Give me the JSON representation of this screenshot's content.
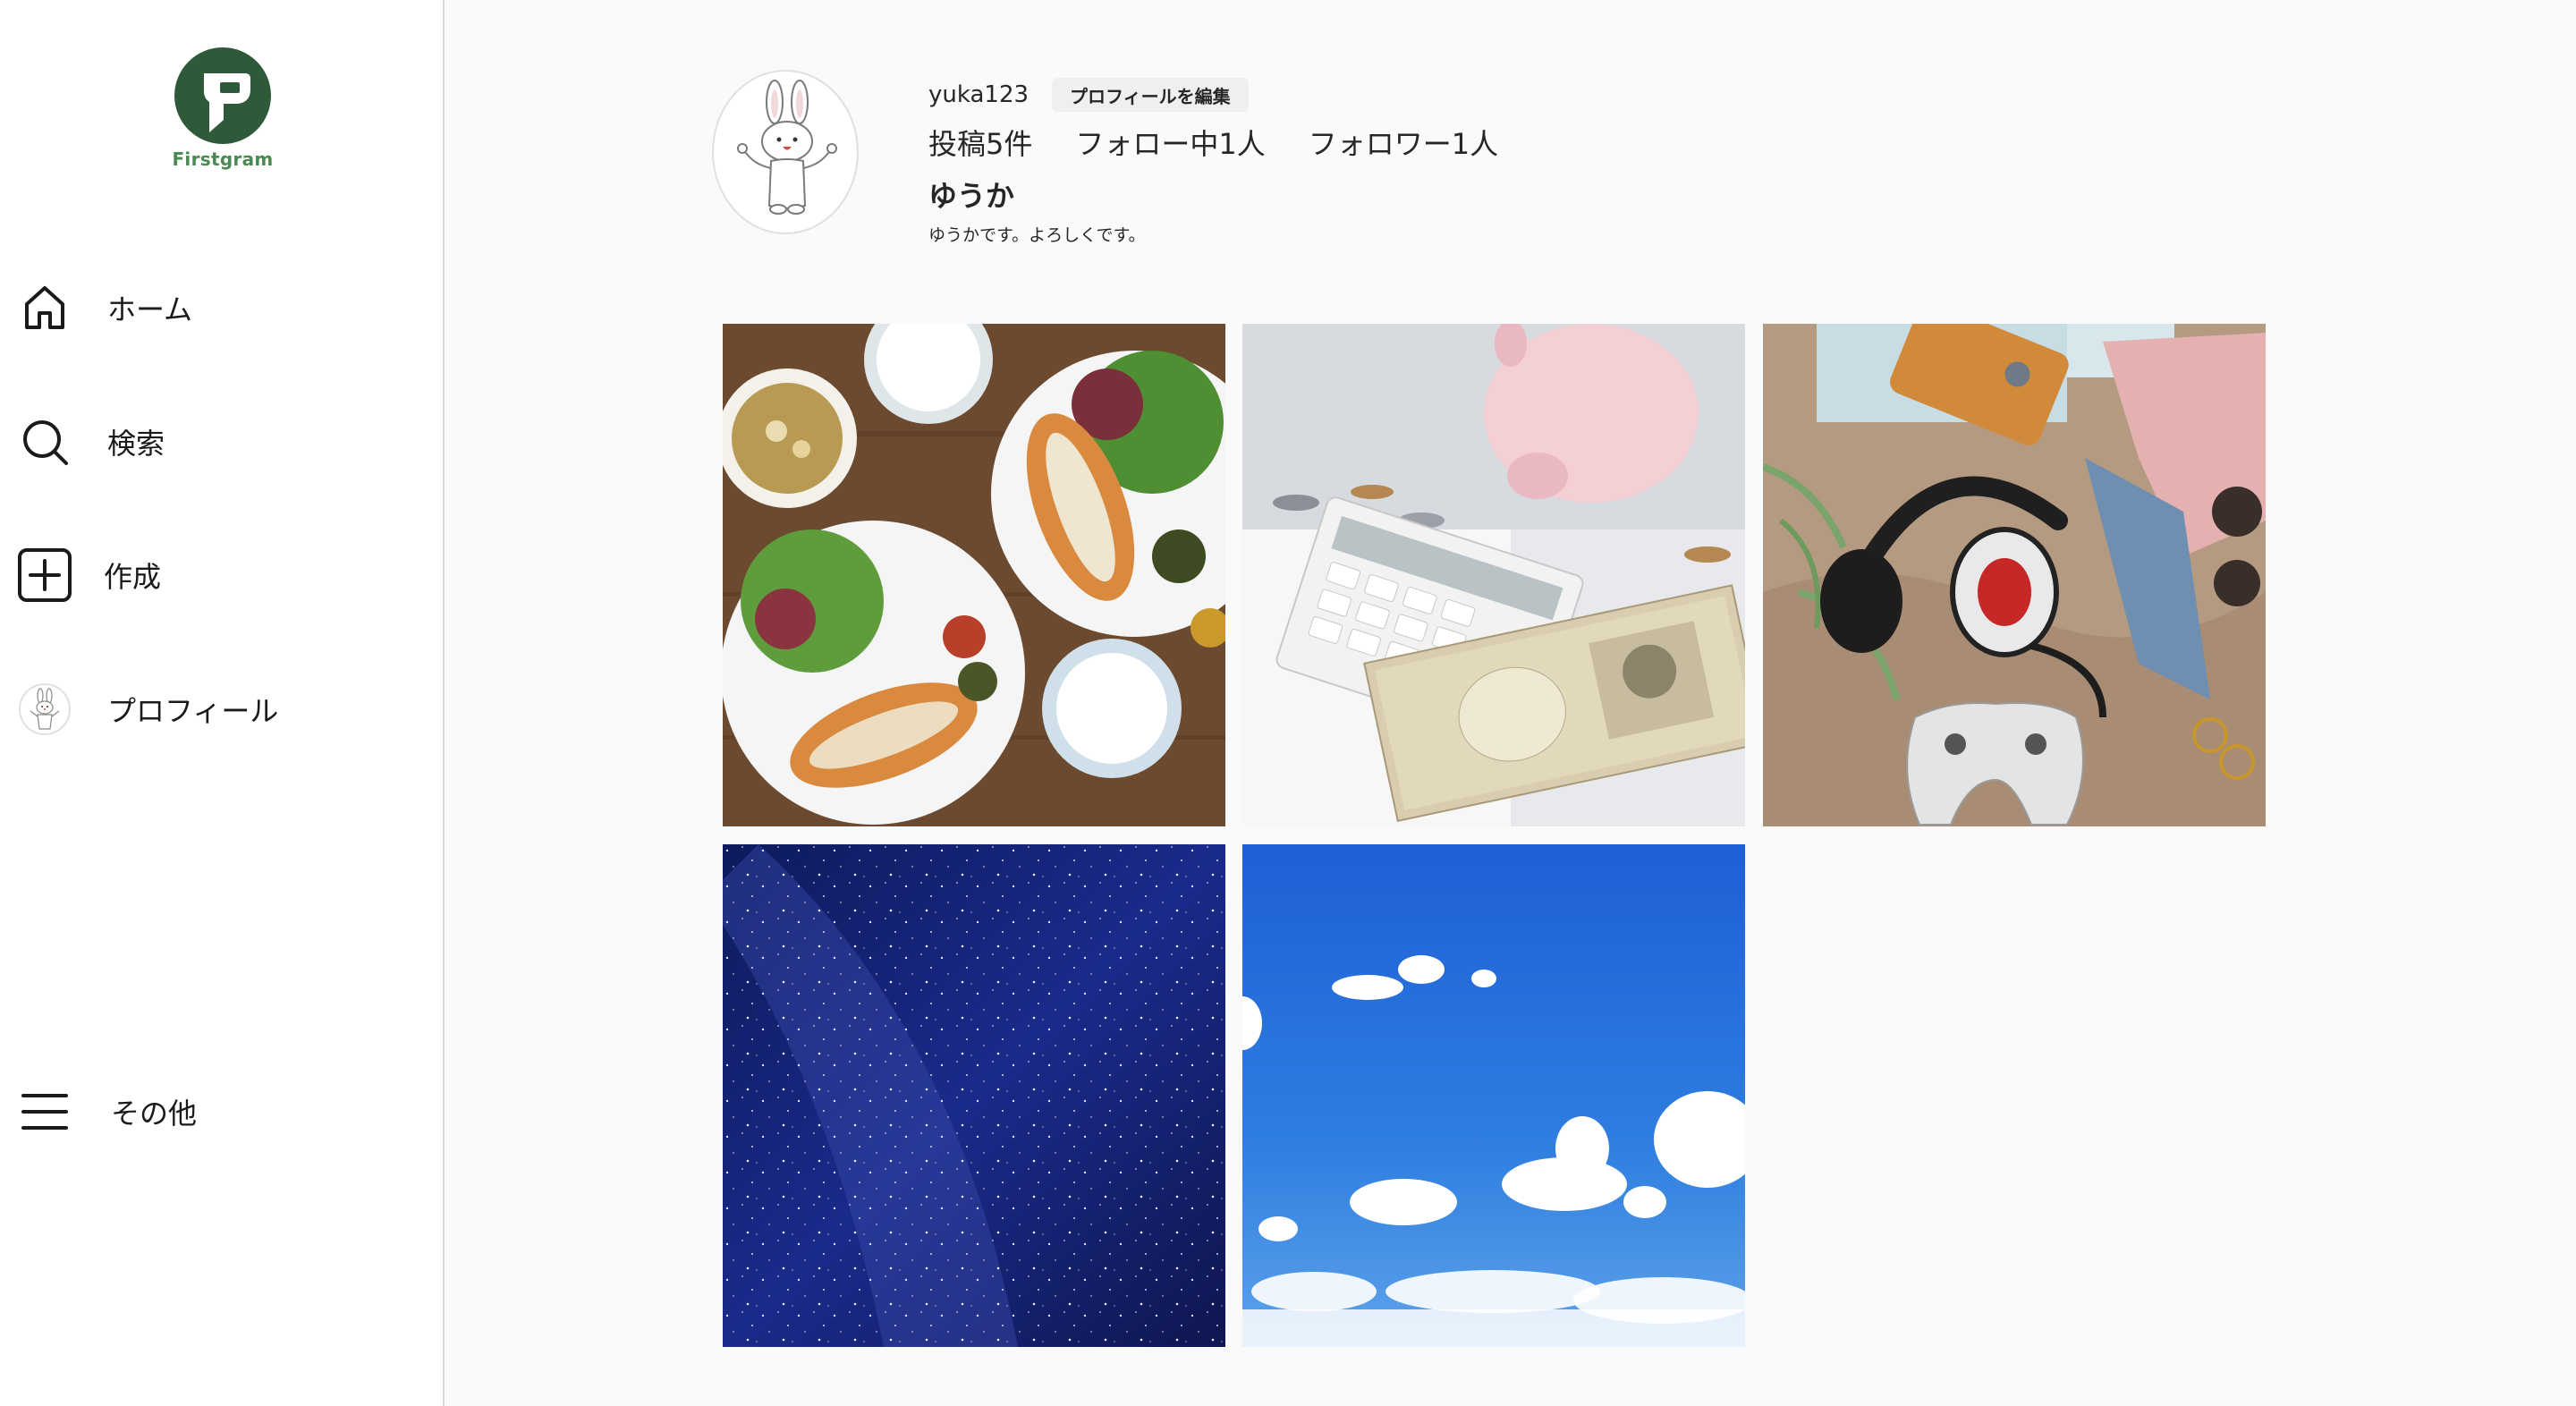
{
  "brand": {
    "name": "Firstgram",
    "logo_color": "#2f5a3a",
    "text_color": "#4a8a52"
  },
  "sidebar": {
    "items": [
      {
        "label": "ホーム",
        "icon": "home-icon"
      },
      {
        "label": "検索",
        "icon": "search-icon"
      },
      {
        "label": "作成",
        "icon": "plus-square-icon"
      },
      {
        "label": "プロフィール",
        "icon": "avatar"
      },
      {
        "label": "その他",
        "icon": "menu-icon"
      }
    ]
  },
  "profile": {
    "username": "yuka123",
    "edit_button": "プロフィールを編集",
    "posts": "投稿5件",
    "following": "フォロー中1人",
    "followers": "フォロワー1人",
    "display_name": "ゆうか",
    "bio": "ゆうかです。よろしくです。"
  },
  "posts": [
    {
      "subject": "food-breakfast-plates"
    },
    {
      "subject": "piggy-bank-calculator-yen"
    },
    {
      "subject": "headphones-controller-flatlay"
    },
    {
      "subject": "starry-night-sky"
    },
    {
      "subject": "blue-sky-clouds"
    }
  ]
}
